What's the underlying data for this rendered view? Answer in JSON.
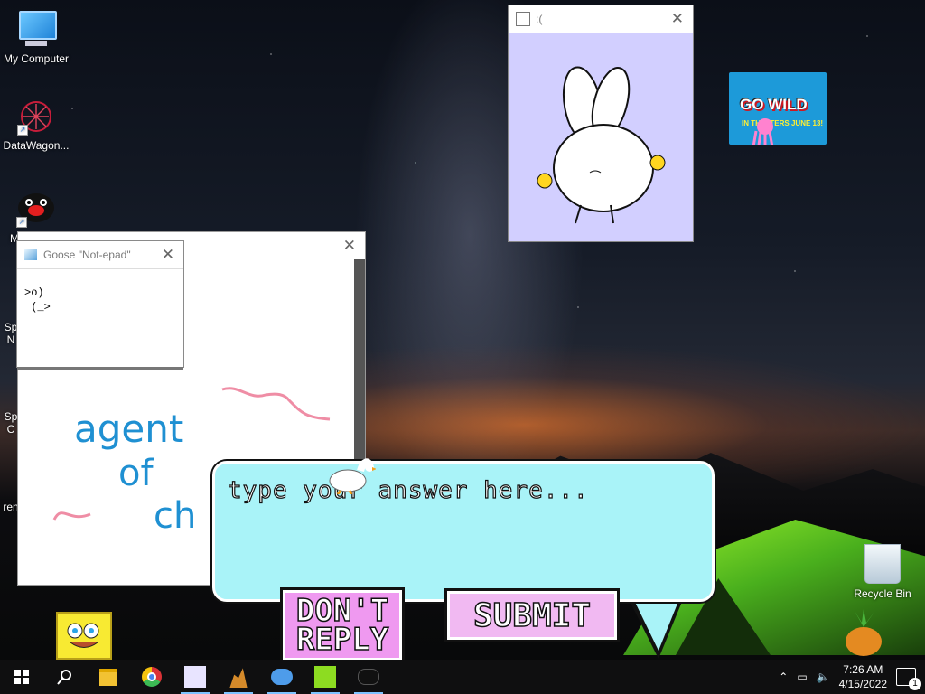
{
  "desktop": {
    "icons": [
      {
        "label": "My Computer"
      },
      {
        "label": "DataWagon..."
      },
      {
        "label": "M"
      },
      {
        "label": "Sp"
      },
      {
        "label": "N"
      },
      {
        "label": "Sp"
      },
      {
        "label": "C"
      },
      {
        "label": "ren"
      }
    ],
    "recycle_bin_label": "Recycle Bin"
  },
  "notepad": {
    "title": "Goose \"Not-epad\"",
    "lines": [
      ">o)",
      " (_>"
    ]
  },
  "drawing": {
    "words": [
      "agent",
      "of",
      "ch"
    ]
  },
  "bunny_window": {
    "title": ":("
  },
  "poster": {
    "title": "GO WILD",
    "subtitle": "IN THEATERS JUNE 13!"
  },
  "answer_box": {
    "placeholder": "type your answer here..."
  },
  "buttons": {
    "dont_reply": "DON'T\nREPLY",
    "submit": "SUBMIT"
  },
  "taskbar": {
    "time": "7:26 AM",
    "date": "4/15/2022",
    "notification_count": "1"
  },
  "colors": {
    "bubble": "#a9f3f8",
    "button_pink": "#ef99f0",
    "bunny_bg": "#d2cfff",
    "taskbar": "#0f0f10"
  }
}
